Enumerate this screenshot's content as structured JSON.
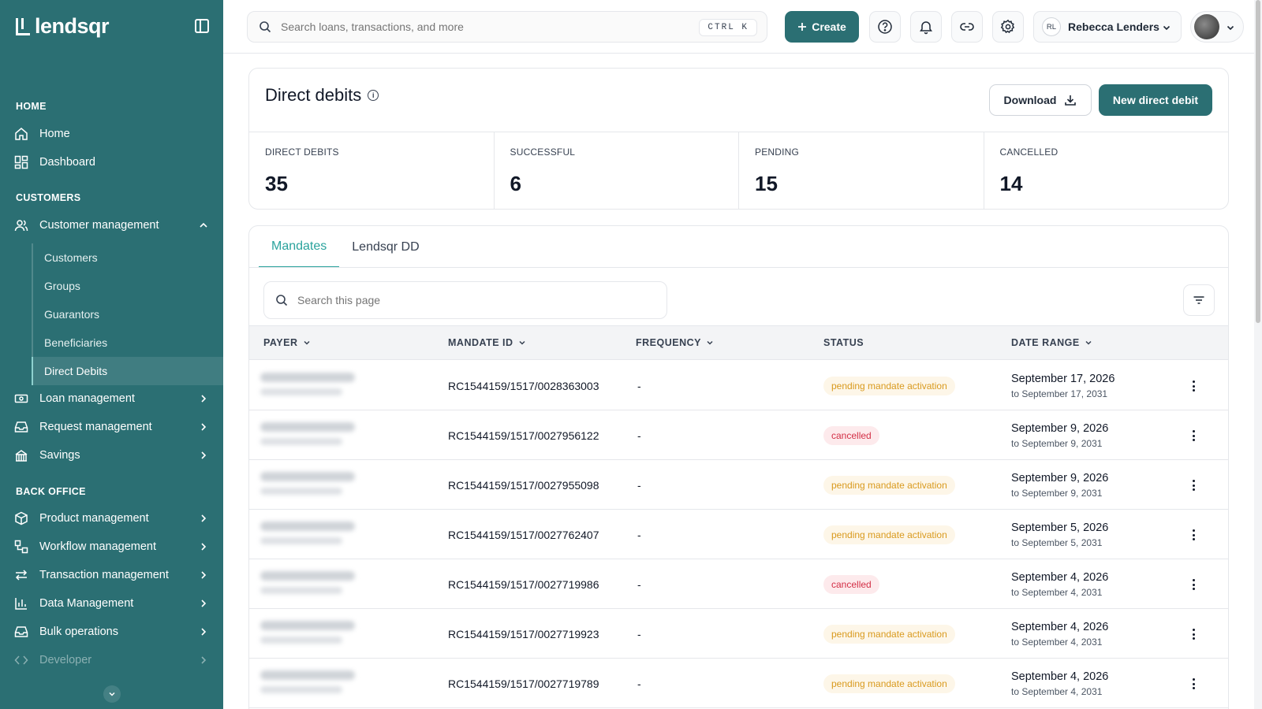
{
  "brand": {
    "name": "lendsqr"
  },
  "sidebar": {
    "sections": {
      "home": "HOME",
      "customers": "CUSTOMERS",
      "back_office": "BACK OFFICE"
    },
    "home_items": [
      {
        "label": "Home",
        "icon": "house-icon"
      },
      {
        "label": "Dashboard",
        "icon": "grid-icon"
      }
    ],
    "customer_management": {
      "label": "Customer management",
      "icon": "users-icon",
      "expanded": true
    },
    "customer_sub_items": [
      {
        "label": "Customers"
      },
      {
        "label": "Groups"
      },
      {
        "label": "Guarantors"
      },
      {
        "label": "Beneficiaries"
      },
      {
        "label": "Direct Debits",
        "active": true
      }
    ],
    "more_customer_items": [
      {
        "label": "Loan management",
        "icon": "money-icon"
      },
      {
        "label": "Request management",
        "icon": "inbox-icon"
      },
      {
        "label": "Savings",
        "icon": "bank-icon"
      }
    ],
    "back_office_items": [
      {
        "label": "Product management",
        "icon": "box-icon"
      },
      {
        "label": "Workflow management",
        "icon": "workflow-icon"
      },
      {
        "label": "Transaction management",
        "icon": "arrows-icon"
      },
      {
        "label": "Data Management",
        "icon": "bar-chart-icon"
      },
      {
        "label": "Bulk operations",
        "icon": "inbox-icon"
      },
      {
        "label": "Developer",
        "icon": "code-icon"
      }
    ]
  },
  "topbar": {
    "search_placeholder": "Search loans, transactions, and more",
    "shortcut": "CTRL K",
    "create_label": "Create",
    "org_initials": "RL",
    "org_name": "Rebecca Lenders"
  },
  "page": {
    "title": "Direct debits",
    "download_label": "Download",
    "new_label": "New direct debit",
    "stats": [
      {
        "label": "DIRECT DEBITS",
        "value": "35"
      },
      {
        "label": "SUCCESSFUL",
        "value": "6"
      },
      {
        "label": "PENDING",
        "value": "15"
      },
      {
        "label": "CANCELLED",
        "value": "14"
      }
    ]
  },
  "tabs": [
    {
      "label": "Mandates",
      "active": true
    },
    {
      "label": "Lendsqr DD",
      "active": false
    }
  ],
  "table": {
    "search_placeholder": "Search this page",
    "columns": [
      "PAYER",
      "MANDATE ID",
      "FREQUENCY",
      "STATUS",
      "DATE RANGE"
    ],
    "rows": [
      {
        "mandate_id": "RC1544159/1517/0028363003",
        "frequency": "-",
        "status": "pending mandate activation",
        "status_type": "pending",
        "date_start": "September 17, 2026",
        "date_end": "to September 17, 2031"
      },
      {
        "mandate_id": "RC1544159/1517/0027956122",
        "frequency": "-",
        "status": "cancelled",
        "status_type": "cancelled",
        "date_start": "September 9, 2026",
        "date_end": "to September 9, 2031"
      },
      {
        "mandate_id": "RC1544159/1517/0027955098",
        "frequency": "-",
        "status": "pending mandate activation",
        "status_type": "pending",
        "date_start": "September 9, 2026",
        "date_end": "to September 9, 2031"
      },
      {
        "mandate_id": "RC1544159/1517/0027762407",
        "frequency": "-",
        "status": "pending mandate activation",
        "status_type": "pending",
        "date_start": "September 5, 2026",
        "date_end": "to September 5, 2031"
      },
      {
        "mandate_id": "RC1544159/1517/0027719986",
        "frequency": "-",
        "status": "cancelled",
        "status_type": "cancelled",
        "date_start": "September 4, 2026",
        "date_end": "to September 4, 2031"
      },
      {
        "mandate_id": "RC1544159/1517/0027719923",
        "frequency": "-",
        "status": "pending mandate activation",
        "status_type": "pending",
        "date_start": "September 4, 2026",
        "date_end": "to September 4, 2031"
      },
      {
        "mandate_id": "RC1544159/1517/0027719789",
        "frequency": "-",
        "status": "pending mandate activation",
        "status_type": "pending",
        "date_start": "September 4, 2026",
        "date_end": "to September 4, 2031"
      }
    ]
  },
  "colors": {
    "brand": "#2b6f73",
    "accent": "#2ba39d",
    "pending_text": "#d99a1e",
    "cancelled_text": "#d32f46"
  }
}
